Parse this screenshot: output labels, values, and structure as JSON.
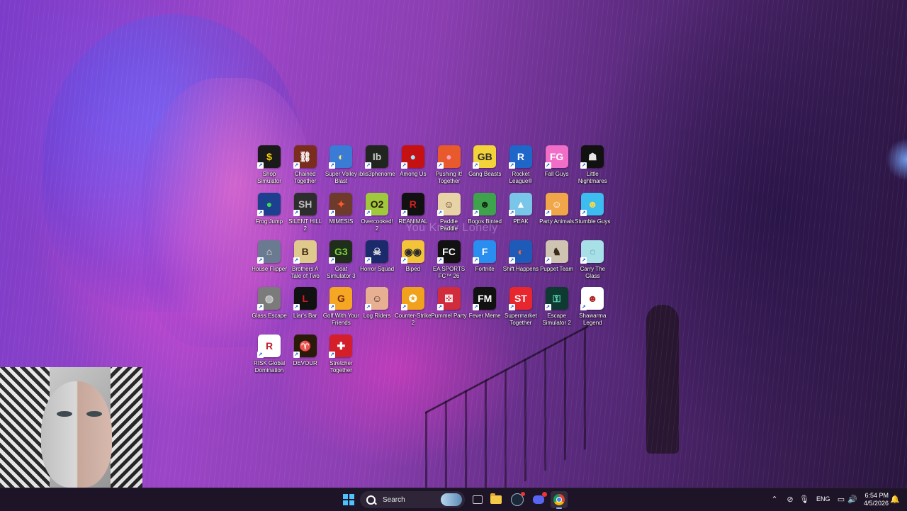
{
  "wallpaper": {
    "overlay_text": "You Know Lonely"
  },
  "desktop_icons": [
    {
      "label": "Shop Simulator",
      "icon": "dollar-coin-icon",
      "glyph": "$",
      "bg": "#1a1a1a",
      "fg": "#ffd400"
    },
    {
      "label": "Chained Together",
      "icon": "chain-icon",
      "glyph": "⛓",
      "bg": "#7a2d1e",
      "fg": "#ffffff"
    },
    {
      "label": "Super Volley Blast",
      "icon": "volleyball-icon",
      "glyph": "◐",
      "bg": "#3a7bd5",
      "fg": "#ffe36e"
    },
    {
      "label": "iblis3phenomenon",
      "icon": "dark-book-icon",
      "glyph": "Ib",
      "bg": "#20261f",
      "fg": "#c7c7c7"
    },
    {
      "label": "Among Us",
      "icon": "crewmate-icon",
      "glyph": "●",
      "bg": "#c51111",
      "fg": "#9be7ff"
    },
    {
      "label": "Pushing it! Together",
      "icon": "orange-planet-icon",
      "glyph": "●",
      "bg": "#e85a2c",
      "fg": "#f3a0c0"
    },
    {
      "label": "Gang Beasts",
      "icon": "gang-beasts-icon",
      "glyph": "GB",
      "bg": "#f3d23a",
      "fg": "#2a2a2a"
    },
    {
      "label": "Rocket League®",
      "icon": "rocket-league-icon",
      "glyph": "R",
      "bg": "#1f66c9",
      "fg": "#ffffff"
    },
    {
      "label": "Fall Guys",
      "icon": "fall-guys-icon",
      "glyph": "FG",
      "bg": "#f06ec8",
      "fg": "#ffffff"
    },
    {
      "label": "Little Nightmares",
      "icon": "little-nightmares-icon",
      "glyph": "☗",
      "bg": "#111111",
      "fg": "#e6e6e6"
    },
    {
      "label": "Frog Jump",
      "icon": "frog-icon",
      "glyph": "●",
      "bg": "#1d3f8f",
      "fg": "#3fdc4b"
    },
    {
      "label": "SILENT HILL 2",
      "icon": "silent-hill-icon",
      "glyph": "SH",
      "bg": "#2d2d2d",
      "fg": "#bbbbbb"
    },
    {
      "label": "MIMESIS",
      "icon": "mimesis-icon",
      "glyph": "✦",
      "bg": "#6d3a2c",
      "fg": "#ff5a2a"
    },
    {
      "label": "Overcooked! 2",
      "icon": "overcooked-icon",
      "glyph": "O2",
      "bg": "#a0c83c",
      "fg": "#2a1a0a"
    },
    {
      "label": "REANIMAL",
      "icon": "reanimal-icon",
      "glyph": "R",
      "bg": "#111111",
      "fg": "#d32020"
    },
    {
      "label": "Paddle Paddle",
      "icon": "paddle-face-icon",
      "glyph": "☺",
      "bg": "#e8d3a6",
      "fg": "#5a3a20"
    },
    {
      "label": "Bogos Binted",
      "icon": "alien-icon",
      "glyph": "☻",
      "bg": "#3fa34d",
      "fg": "#0e2a12"
    },
    {
      "label": "PEAK",
      "icon": "mountain-icon",
      "glyph": "▲",
      "bg": "#7ac6e8",
      "fg": "#ffffff"
    },
    {
      "label": "Party Animals",
      "icon": "dog-icon",
      "glyph": "☺",
      "bg": "#f2a64a",
      "fg": "#ffffff"
    },
    {
      "label": "Stumble Guys",
      "icon": "stumble-guys-icon",
      "glyph": "☻",
      "bg": "#3dbcf0",
      "fg": "#f5d94b"
    },
    {
      "label": "House Flipper",
      "icon": "house-flipper-icon",
      "glyph": "⌂",
      "bg": "#6a7a90",
      "fg": "#e6e6e6"
    },
    {
      "label": "Brothers A Tale of Two Sons",
      "icon": "brothers-icon",
      "glyph": "B",
      "bg": "#e0c98c",
      "fg": "#3a2a10"
    },
    {
      "label": "Goat Simulator 3",
      "icon": "goat-sim-icon",
      "glyph": "G3",
      "bg": "#1e2e1a",
      "fg": "#7bd23c"
    },
    {
      "label": "Horror Squad",
      "icon": "horror-squad-icon",
      "glyph": "☠",
      "bg": "#1b2a6b",
      "fg": "#dcdcdc"
    },
    {
      "label": "Biped",
      "icon": "biped-icon",
      "glyph": "◉◉",
      "bg": "#f3c43a",
      "fg": "#2a2a2a"
    },
    {
      "label": "EA SPORTS FC™ 26",
      "icon": "ea-fc-icon",
      "glyph": "FC",
      "bg": "#111111",
      "fg": "#ffffff"
    },
    {
      "label": "Fortnite",
      "icon": "fortnite-icon",
      "glyph": "F",
      "bg": "#2a8df0",
      "fg": "#ffffff"
    },
    {
      "label": "Shift Happens",
      "icon": "shift-happens-icon",
      "glyph": "◐",
      "bg": "#1e5bb8",
      "fg": "#ff6a3a"
    },
    {
      "label": "Puppet Team",
      "icon": "puppet-icon",
      "glyph": "♞",
      "bg": "#cfc4b2",
      "fg": "#3a2a1a"
    },
    {
      "label": "Carry The Glass",
      "icon": "glass-icon",
      "glyph": "◌",
      "bg": "#a8e0e8",
      "fg": "#2a6a70"
    },
    {
      "label": "Glass Escape",
      "icon": "glass-escape-icon",
      "glyph": "◍",
      "bg": "#7b7b7b",
      "fg": "#d0d0d0"
    },
    {
      "label": "Liar's Bar",
      "icon": "liars-bar-icon",
      "glyph": "L",
      "bg": "#111111",
      "fg": "#d31e1e"
    },
    {
      "label": "Golf With Your Friends",
      "icon": "golf-icon",
      "glyph": "G",
      "bg": "#f5a623",
      "fg": "#7a2a12"
    },
    {
      "label": "Log Riders",
      "icon": "log-riders-icon",
      "glyph": "☺",
      "bg": "#e8b093",
      "fg": "#3a2a2a"
    },
    {
      "label": "Counter-Strike 2",
      "icon": "counter-strike-icon",
      "glyph": "✪",
      "bg": "#f0a21c",
      "fg": "#ffffff"
    },
    {
      "label": "Pummel Party",
      "icon": "dice-icon",
      "glyph": "⚄",
      "bg": "#d02c3c",
      "fg": "#ffffff"
    },
    {
      "label": "Fever Meme",
      "icon": "fever-meme-icon",
      "glyph": "FM",
      "bg": "#111111",
      "fg": "#ffffff"
    },
    {
      "label": "Supermarket Together",
      "icon": "supermarket-icon",
      "glyph": "ST",
      "bg": "#e8262e",
      "fg": "#ffffff"
    },
    {
      "label": "Escape Simulator 2",
      "icon": "keyhole-icon",
      "glyph": "⚿",
      "bg": "#0e3a32",
      "fg": "#5ee0b8"
    },
    {
      "label": "Shawarma Legend",
      "icon": "shawarma-icon",
      "glyph": "☻",
      "bg": "#ffffff",
      "fg": "#b22222"
    },
    {
      "label": "RISK Global Domination",
      "icon": "risk-icon",
      "glyph": "R",
      "bg": "#ffffff",
      "fg": "#c41e2e"
    },
    {
      "label": "DEVOUR",
      "icon": "devour-icon",
      "glyph": "♈",
      "bg": "#2a1a0a",
      "fg": "#e07a1a"
    },
    {
      "label": "Stretcher Together",
      "icon": "stretcher-cross-icon",
      "glyph": "✚",
      "bg": "#d41f2a",
      "fg": "#ffffff"
    }
  ],
  "taskbar": {
    "search_label": "Search",
    "apps": [
      {
        "name": "task-view",
        "icon": "task-view-icon"
      },
      {
        "name": "file-explorer",
        "icon": "folder-icon"
      },
      {
        "name": "steam",
        "icon": "steam-icon"
      },
      {
        "name": "discord",
        "icon": "discord-icon"
      },
      {
        "name": "chrome",
        "icon": "chrome-icon",
        "active": true
      }
    ],
    "tray": {
      "language": "ENG",
      "time": "6:54 PM",
      "date": "4/5/2026"
    }
  },
  "colors": {
    "taskbar_bg": "#1d1428",
    "accent": "#4cc2ff"
  }
}
